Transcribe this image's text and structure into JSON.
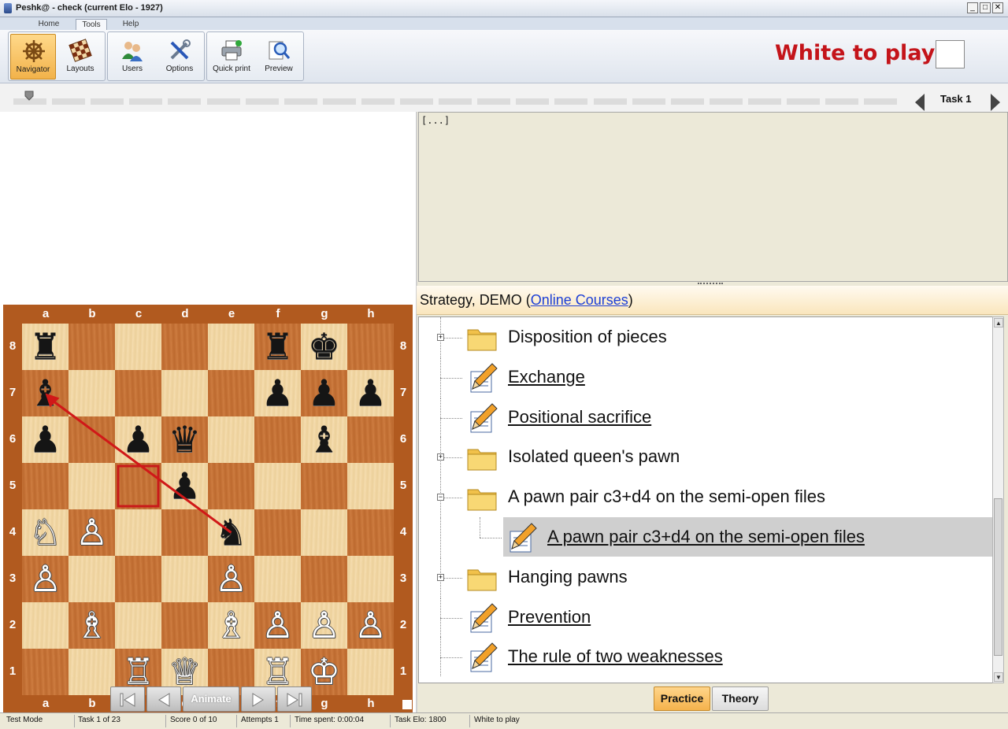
{
  "window": {
    "title": "Peshk@ -  check (current Elo - 1927)",
    "buttons": [
      "_",
      "□",
      "✕"
    ]
  },
  "menu_tabs": [
    "Home",
    "Tools",
    "Help"
  ],
  "active_menu_tab": "Tools",
  "ribbon": {
    "navigator": "Navigator",
    "layouts": "Layouts",
    "users": "Users",
    "options": "Options",
    "quick_print": "Quick print",
    "preview": "Preview"
  },
  "side_to_move": {
    "text": "White to play",
    "color": "#c4141a"
  },
  "task_nav": {
    "label": "Task  1"
  },
  "board": {
    "files": [
      "a",
      "b",
      "c",
      "d",
      "e",
      "f",
      "g",
      "h"
    ],
    "ranks": [
      "8",
      "7",
      "6",
      "5",
      "4",
      "3",
      "2",
      "1"
    ],
    "pieces": [
      {
        "sq": "a8",
        "p": "♜",
        "c": "b"
      },
      {
        "sq": "f8",
        "p": "♜",
        "c": "b"
      },
      {
        "sq": "g8",
        "p": "♚",
        "c": "b"
      },
      {
        "sq": "a7",
        "p": "♝",
        "c": "b"
      },
      {
        "sq": "f7",
        "p": "♟",
        "c": "b"
      },
      {
        "sq": "g7",
        "p": "♟",
        "c": "b"
      },
      {
        "sq": "h7",
        "p": "♟",
        "c": "b"
      },
      {
        "sq": "a6",
        "p": "♟",
        "c": "b"
      },
      {
        "sq": "c6",
        "p": "♟",
        "c": "b"
      },
      {
        "sq": "d6",
        "p": "♛",
        "c": "b"
      },
      {
        "sq": "g6",
        "p": "♝",
        "c": "b"
      },
      {
        "sq": "d5",
        "p": "♟",
        "c": "b"
      },
      {
        "sq": "a4",
        "p": "♘",
        "c": "w"
      },
      {
        "sq": "b4",
        "p": "♙",
        "c": "w"
      },
      {
        "sq": "e4",
        "p": "♞",
        "c": "b"
      },
      {
        "sq": "a3",
        "p": "♙",
        "c": "w"
      },
      {
        "sq": "e3",
        "p": "♙",
        "c": "w"
      },
      {
        "sq": "b2",
        "p": "♗",
        "c": "w"
      },
      {
        "sq": "e2",
        "p": "♗",
        "c": "w"
      },
      {
        "sq": "f2",
        "p": "♙",
        "c": "w"
      },
      {
        "sq": "g2",
        "p": "♙",
        "c": "w"
      },
      {
        "sq": "h2",
        "p": "♙",
        "c": "w"
      },
      {
        "sq": "c1",
        "p": "♖",
        "c": "w"
      },
      {
        "sq": "d1",
        "p": "♕",
        "c": "w"
      },
      {
        "sq": "f1",
        "p": "♖",
        "c": "w"
      },
      {
        "sq": "g1",
        "p": "♔",
        "c": "w"
      }
    ],
    "highlight_square": "c5",
    "arrow": {
      "from": "e4",
      "to": "a7",
      "color": "#d01818"
    }
  },
  "nav_buttons": {
    "animate": "Animate"
  },
  "notes": {
    "text": "[...]"
  },
  "course": {
    "name": "Strategy, DEMO (",
    "link": "Online Courses",
    "close": ")"
  },
  "tree": [
    {
      "label": "Disposition of pieces",
      "type": "folder",
      "expander": "+",
      "link": false
    },
    {
      "label": "Exchange",
      "type": "task",
      "expander": "",
      "link": true
    },
    {
      "label": "Positional sacrifice",
      "type": "task",
      "expander": "",
      "link": true
    },
    {
      "label": "Isolated queen's pawn",
      "type": "folder",
      "expander": "+",
      "link": false
    },
    {
      "label": "A pawn pair c3+d4 on the semi-open files",
      "type": "folder",
      "expander": "−",
      "link": false
    },
    {
      "label": "A pawn pair c3+d4 on the semi-open files",
      "type": "task",
      "expander": "",
      "link": true,
      "child": true,
      "selected": true
    },
    {
      "label": "Hanging pawns",
      "type": "folder",
      "expander": "+",
      "link": false
    },
    {
      "label": "Prevention",
      "type": "task",
      "expander": "",
      "link": true
    },
    {
      "label": "The rule of two weaknesses",
      "type": "task",
      "expander": "",
      "link": true
    }
  ],
  "mode_buttons": {
    "practice": "Practice",
    "theory": "Theory",
    "active": "Practice"
  },
  "status": {
    "mode": "Test Mode",
    "task": "Task 1 of 23",
    "score": "Score 0 of 10",
    "attempts": "Attempts 1",
    "time": "Time spent: 0:00:04",
    "elo": "Task Elo: 1800",
    "to_play": "White to play"
  }
}
